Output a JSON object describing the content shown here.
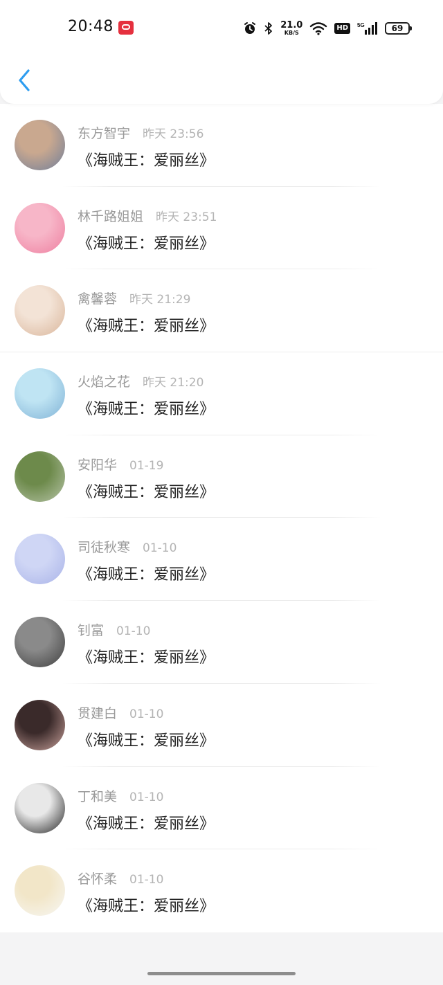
{
  "status_bar": {
    "time": "20:48",
    "net_speed": "21.0",
    "net_unit": "KB/S",
    "hd_label": "HD",
    "signal_label": "5G",
    "battery": "69"
  },
  "header": {
    "back_icon": "chevron-left-icon",
    "accent_color": "#2e9df0"
  },
  "messages": [
    {
      "name": "东方智宇",
      "time": "昨天 23:56",
      "content": "《海贼王：爱丽丝》",
      "avatar_colors": [
        "#c9a88f",
        "#6f7e9a"
      ]
    },
    {
      "name": "林千路姐姐",
      "time": "昨天 23:51",
      "content": "《海贼王：爱丽丝》",
      "avatar_colors": [
        "#f7b6c8",
        "#ee7fa0"
      ]
    },
    {
      "name": "禽馨蓉",
      "time": "昨天 21:29",
      "content": "《海贼王：爱丽丝》",
      "avatar_colors": [
        "#f3e3d6",
        "#d9b59a"
      ]
    },
    {
      "name": "火焰之花",
      "time": "昨天 21:20",
      "content": "《海贼王：爱丽丝》",
      "avatar_colors": [
        "#bfe4f3",
        "#7fb2d6"
      ]
    },
    {
      "name": "安阳华",
      "time": "01-19",
      "content": "《海贼王：爱丽丝》",
      "avatar_colors": [
        "#6d8a4b",
        "#b7c4a8"
      ]
    },
    {
      "name": "司徒秋寒",
      "time": "01-10",
      "content": "《海贼王：爱丽丝》",
      "avatar_colors": [
        "#cfd6f5",
        "#a9b3e8"
      ]
    },
    {
      "name": "钊富",
      "time": "01-10",
      "content": "《海贼王：爱丽丝》",
      "avatar_colors": [
        "#8a8a8a",
        "#3f3f3f"
      ]
    },
    {
      "name": "贯建白",
      "time": "01-10",
      "content": "《海贼王：爱丽丝》",
      "avatar_colors": [
        "#3a2a2a",
        "#c9a19b"
      ]
    },
    {
      "name": "丁和美",
      "time": "01-10",
      "content": "《海贼王：爱丽丝》",
      "avatar_colors": [
        "#e8e8e8",
        "#222222"
      ]
    },
    {
      "name": "谷怀柔",
      "time": "01-10",
      "content": "《海贼王：爱丽丝》",
      "avatar_colors": [
        "#f2e6c8",
        "#f7f7f4"
      ]
    }
  ]
}
